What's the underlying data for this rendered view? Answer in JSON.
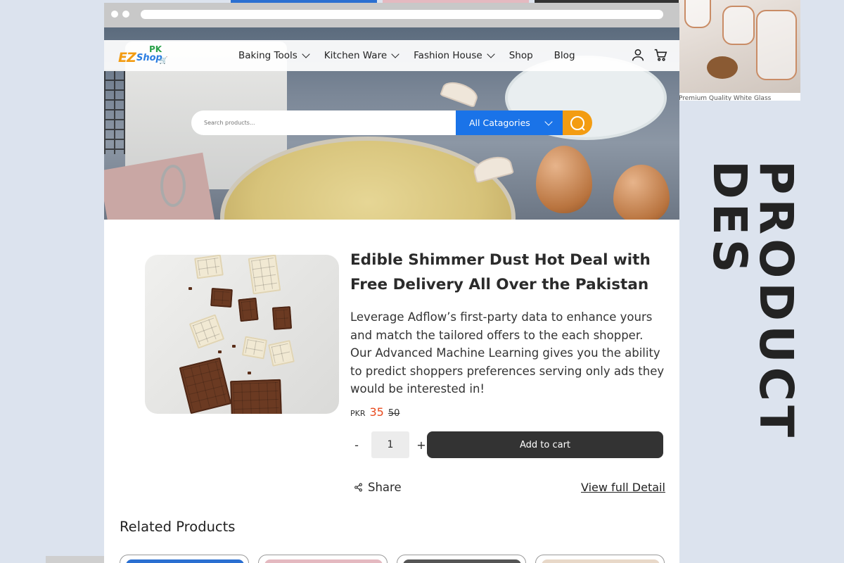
{
  "colors": {
    "brand_blue": "#1a73e8",
    "brand_orange": "#f39c12",
    "price_red": "#e8491d",
    "dark_button": "#333333",
    "page_bg": "#dce3ee"
  },
  "side_panel": {
    "product_caption": "Premium Quality White Glass",
    "vertical_title": "PRODUCT DES"
  },
  "header": {
    "logo": {
      "ez": "EZ",
      "shop": "Shop",
      "pk": "PK"
    },
    "menu": [
      {
        "label": "Baking Tools",
        "has_dropdown": true
      },
      {
        "label": "Kitchen Ware",
        "has_dropdown": true
      },
      {
        "label": "Fashion House",
        "has_dropdown": true
      },
      {
        "label": "Shop",
        "has_dropdown": false
      },
      {
        "label": "Blog",
        "has_dropdown": false
      }
    ],
    "icons": [
      "user-icon",
      "cart-icon"
    ]
  },
  "search": {
    "placeholder": "Search products...",
    "category_label": "All Catagories",
    "button_icon": "search-icon"
  },
  "product": {
    "title": "Edible Shimmer Dust Hot Deal with Free Delivery All Over the Pakistan",
    "description": "Leverage Adflow’s first-party data to enhance yours and match the tailored offers to the each shopper. Our Advanced Machine Learning gives you the ability to predict shoppers preferences serving only ads they would be interested in!",
    "currency": "PKR",
    "price": "35",
    "old_price": "50",
    "quantity": "1",
    "minus_label": "-",
    "plus_label": "+",
    "add_to_cart_label": "Add to cart",
    "share_label": "Share",
    "view_detail_label": "View full Detail"
  },
  "related": {
    "heading": "Related Products"
  }
}
